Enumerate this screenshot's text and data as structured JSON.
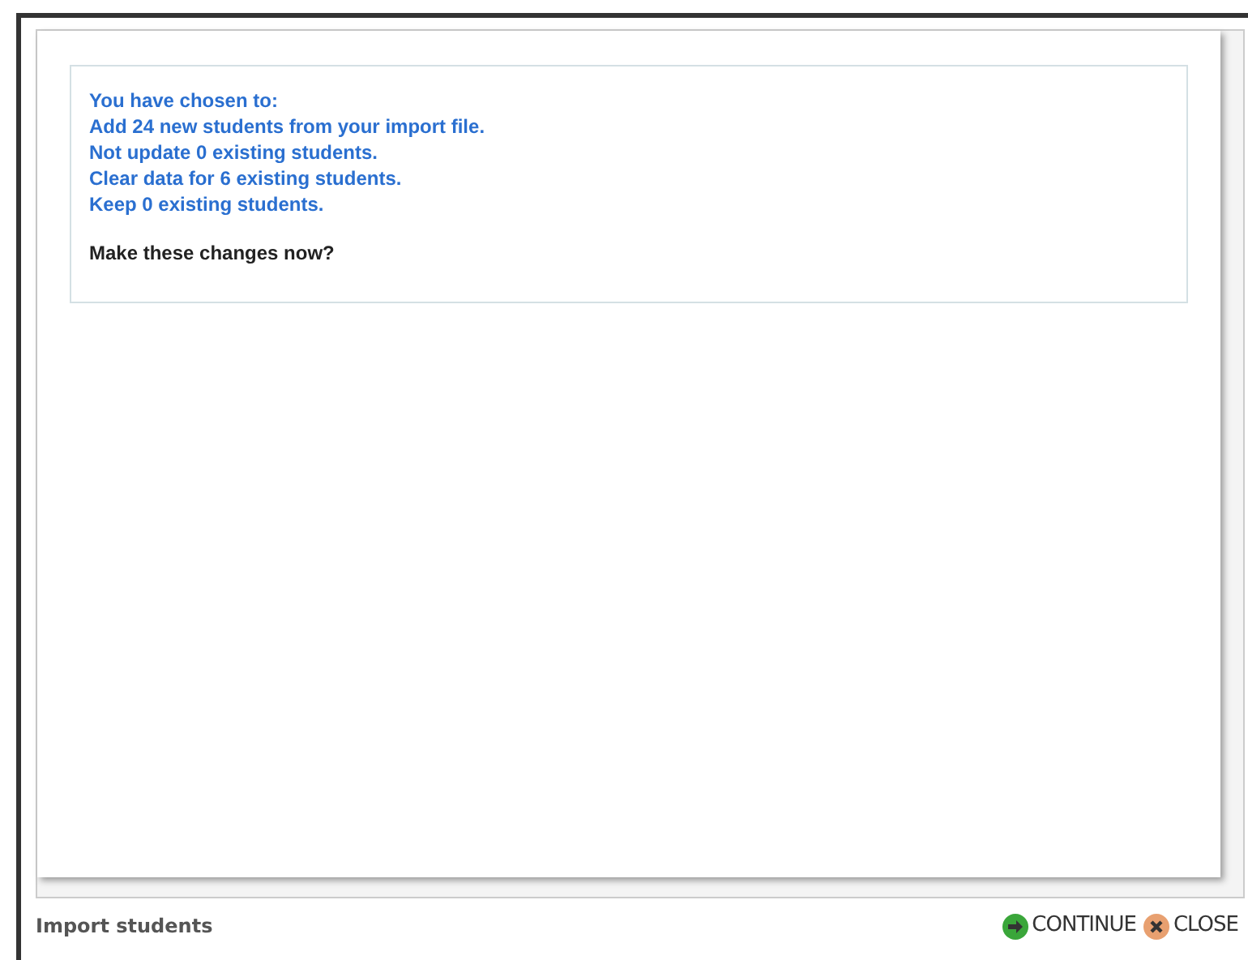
{
  "summary": {
    "lines": [
      "You have chosen to:",
      "Add 24 new students from your import file.",
      "Not update 0 existing students.",
      "Clear data for 6 existing students.",
      "Keep 0 existing students."
    ],
    "question": "Make these changes now?"
  },
  "footer": {
    "title": "Import students",
    "buttons": [
      {
        "kind": "continue",
        "label": "CONTINUE"
      },
      {
        "kind": "close",
        "label": "CLOSE"
      }
    ]
  }
}
